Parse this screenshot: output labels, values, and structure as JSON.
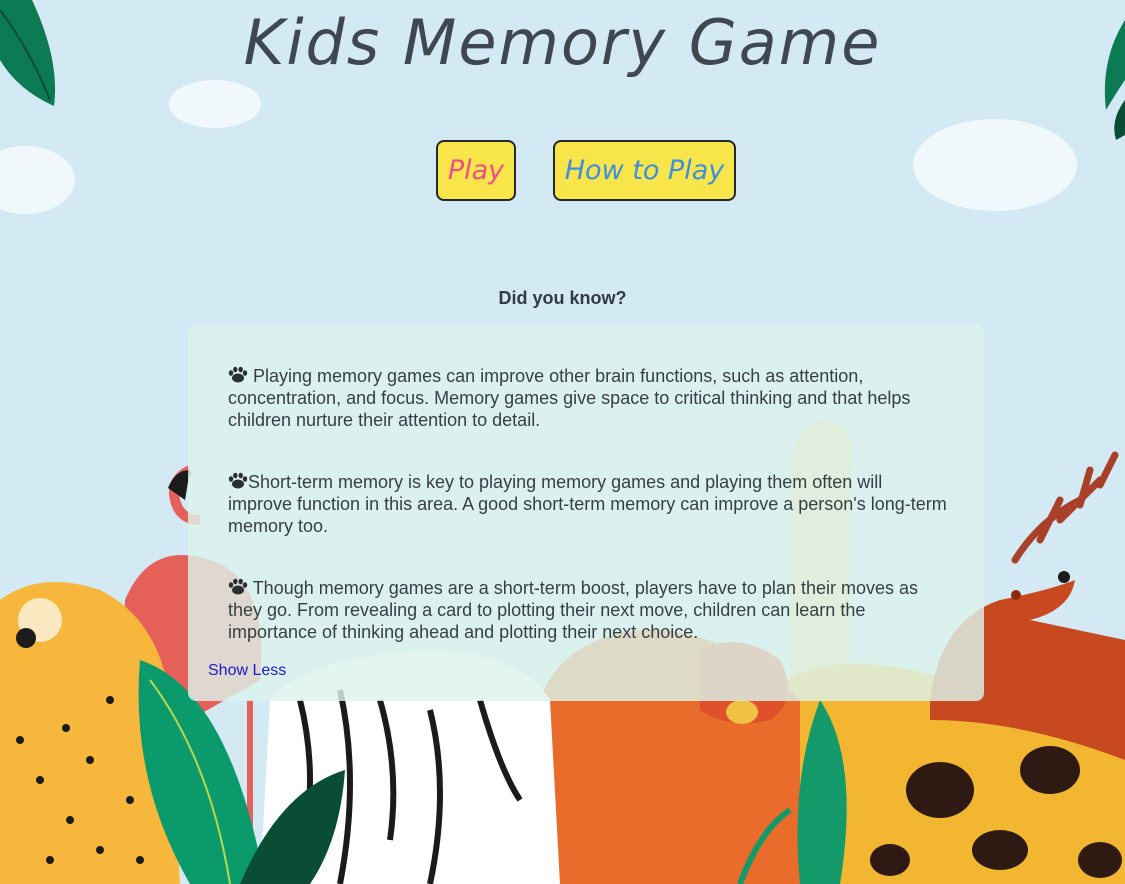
{
  "page": {
    "title": "Kids Memory Game"
  },
  "buttons": {
    "play": "Play",
    "how_to_play": "How to Play"
  },
  "did_you_know": {
    "heading": "Did you know?",
    "facts": [
      "Playing memory games can improve other brain functions, such as attention, concentration, and focus. Memory games give space to critical thinking and that helps children nurture their attention to detail.",
      "Short-term memory is key to playing memory games and playing them often will improve function in this area. A good short-term memory can improve a person's long-term memory too.",
      "Though memory games are a short-term boost, players have to plan their moves as they go. From revealing a card to plotting their next move, children can learn the importance of thinking ahead and plotting their next choice."
    ],
    "toggle_label": "Show Less"
  },
  "icons": {
    "fact_bullet": "paw-icon"
  },
  "colors": {
    "background": "#d3e9f4",
    "button_fill": "#f7e54a",
    "play_text": "#ee4f8a",
    "how_to_play_text": "#3d8fe0",
    "link": "#1a19c8"
  }
}
